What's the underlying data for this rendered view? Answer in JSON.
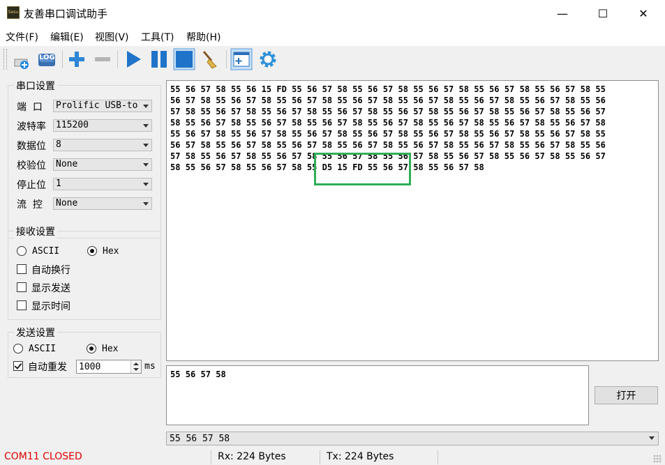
{
  "window": {
    "title": "友善串口调试助手",
    "app_icon_text": "Sesu",
    "minimize_glyph": "—",
    "maximize_glyph": "☐",
    "close_glyph": "✕"
  },
  "menu": [
    "文件(F)",
    "编辑(E)",
    "视图(V)",
    "工具(T)",
    "帮助(H)"
  ],
  "toolbar": {
    "log_label": "LOG",
    "buttons": [
      "new-session-icon",
      "log-icon",
      "add-icon",
      "remove-icon",
      "play-icon",
      "pause-icon",
      "stop-icon",
      "clear-broom-icon",
      "new-window-icon",
      "settings-gear-icon"
    ]
  },
  "serial_settings": {
    "title": "串口设置",
    "port_label": "端  口",
    "port_value": "Prolific USB-to",
    "baud_label": "波特率",
    "baud_value": "115200",
    "databits_label": "数据位",
    "databits_value": "8",
    "parity_label": "校验位",
    "parity_value": "None",
    "stopbits_label": "停止位",
    "stopbits_value": "1",
    "flow_label": "流  控",
    "flow_value": "None"
  },
  "receive_settings": {
    "title": "接收设置",
    "ascii_label": "ASCII",
    "hex_label": "Hex",
    "selected": "Hex",
    "auto_wrap_label": "自动换行",
    "show_send_label": "显示发送",
    "show_time_label": "显示时间",
    "auto_wrap_checked": false,
    "show_send_checked": false,
    "show_time_checked": false
  },
  "send_settings": {
    "title": "发送设置",
    "ascii_label": "ASCII",
    "hex_label": "Hex",
    "selected": "Hex",
    "auto_resend_label": "自动重发",
    "auto_resend_checked": true,
    "interval_value": "1000",
    "interval_unit": "ms"
  },
  "receive_lines": [
    "55 56 57 58 55 56 15 FD 55 56 57 58 55 56 57 58 55 56 57 58 55 56 57 58 55 56 57 58 55",
    "56 57 58 55 56 57 58 55 56 57 58 55 56 57 58 55 56 57 58 55 56 57 58 55 56 57 58 55 56",
    "57 58 55 56 57 58 55 56 57 58 55 56 57 58 55 56 57 58 55 56 57 58 55 56 57 58 55 56 57",
    "58 55 56 57 58 55 56 57 58 55 56 57 58 55 56 57 58 55 56 57 58 55 56 57 58 55 56 57 58",
    "55 56 57 58 55 56 57 58 55 56 57 58 55 56 57 58 55 56 57 58 55 56 57 58 55 56 57 58 55",
    "56 57 58 55 56 57 58 55 56 57 58 55 56 57 58 55 56 57 58 55 56 57 58 55 56 57 58 55 56",
    "57 58 55 56 57 58 55 56 57 58 55 56 57 58 55 56 57 58 55 56 57 58 55 56 57 58 55 56 57",
    "58 55 56 57 58 55 56 57 58 55 D5 15 FD 55 56 57 58 55 56 57 58"
  ],
  "send_text": "55 56 57 58",
  "open_button_label": "打开",
  "history_value": "55 56 57 58",
  "status": {
    "port_status": "COM11 CLOSED",
    "port_status_color": "#e00000",
    "rx": "Rx: 224 Bytes",
    "tx": "Tx: 224 Bytes"
  },
  "highlight_color": "#2fae55"
}
